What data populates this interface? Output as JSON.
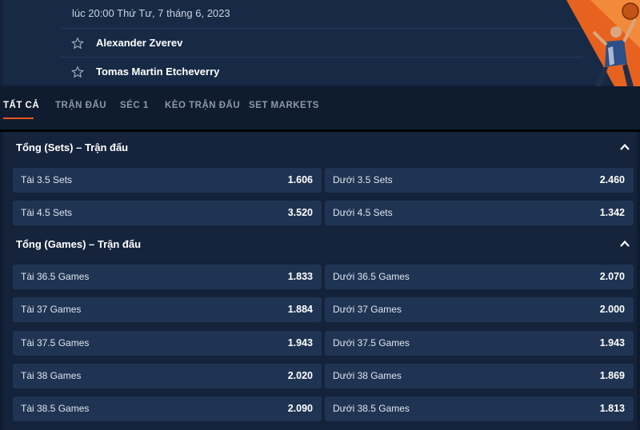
{
  "header": {
    "match_time": "lúc 20:00 Thứ Tư, 7 tháng 6, 2023",
    "player1": "Alexander Zverev",
    "player2": "Tomas Martin Etcheverry"
  },
  "tabs": [
    {
      "label": "TẤT CẢ",
      "active": true
    },
    {
      "label": "TRẬN ĐẤU",
      "active": false
    },
    {
      "label": "SÉC 1",
      "active": false
    },
    {
      "label": "KÈO TRẬN ĐẤU",
      "active": false
    },
    {
      "label": "SET MARKETS",
      "active": false
    }
  ],
  "sections": [
    {
      "title": "Tổng (Sets) – Trận đấu",
      "rows": [
        {
          "over_label": "Tài 3.5 Sets",
          "over_price": "1.606",
          "under_label": "Dưới 3.5 Sets",
          "under_price": "2.460"
        },
        {
          "over_label": "Tài 4.5 Sets",
          "over_price": "3.520",
          "under_label": "Dưới 4.5 Sets",
          "under_price": "1.342"
        }
      ]
    },
    {
      "title": "Tổng (Games) – Trận đấu",
      "rows": [
        {
          "over_label": "Tài 36.5 Games",
          "over_price": "1.833",
          "under_label": "Dưới 36.5 Games",
          "under_price": "2.070"
        },
        {
          "over_label": "Tài 37 Games",
          "over_price": "1.884",
          "under_label": "Dưới 37 Games",
          "under_price": "2.000"
        },
        {
          "over_label": "Tài 37.5 Games",
          "over_price": "1.943",
          "under_label": "Dưới 37.5 Games",
          "under_price": "1.943"
        },
        {
          "over_label": "Tài 38 Games",
          "over_price": "2.020",
          "under_label": "Dưới 38 Games",
          "under_price": "1.869"
        },
        {
          "over_label": "Tài 38.5 Games",
          "over_price": "2.090",
          "under_label": "Dưới 38.5 Games",
          "under_price": "1.813"
        }
      ]
    }
  ],
  "colors": {
    "accent": "#e85a1a",
    "background": "#0f1b2e",
    "odd_button": "#1f3452"
  },
  "icons": [
    "star-icon",
    "chevron-up-icon",
    "tennis-player-promo-image"
  ]
}
